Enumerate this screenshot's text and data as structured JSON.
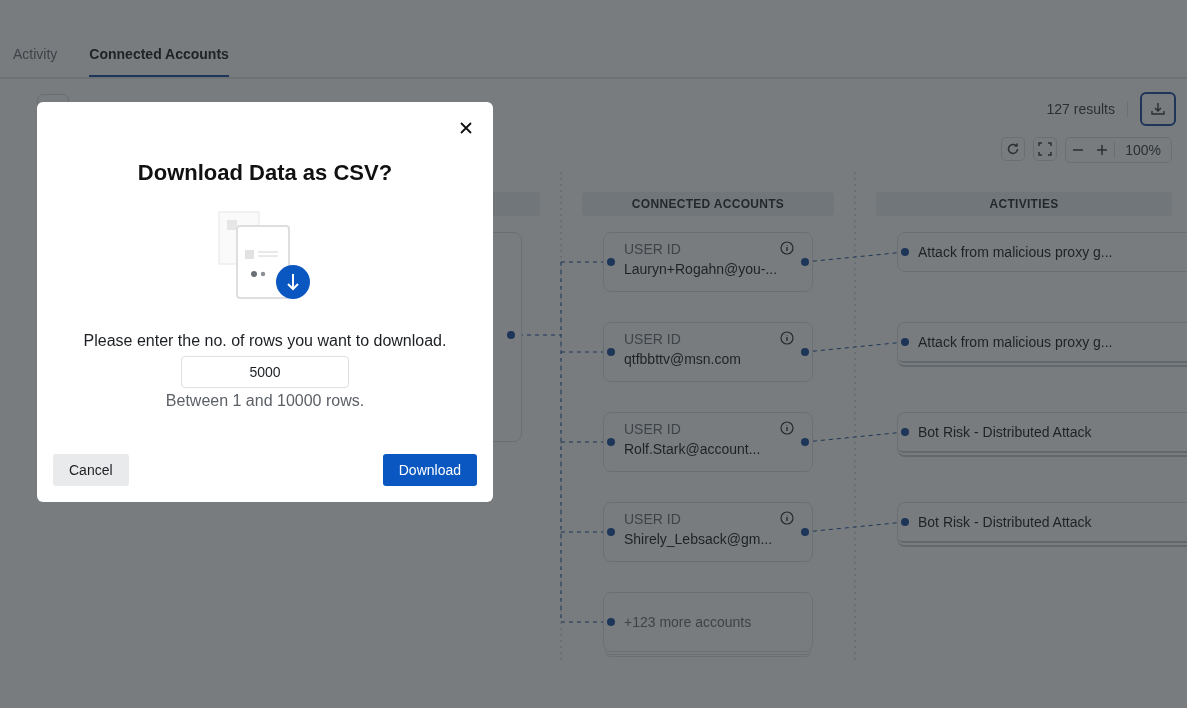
{
  "tabs": [
    {
      "label": "Activity",
      "selected": false
    },
    {
      "label": "Connected Accounts",
      "selected": true
    }
  ],
  "results": "127 results",
  "zoom": "100%",
  "graph": {
    "columns": [
      {
        "header": "CONNECTED ACCOUNTS"
      },
      {
        "header": "ACTIVITIES"
      }
    ],
    "accounts": [
      {
        "label": "USER ID",
        "value": "Lauryn+Rogahn@you-..."
      },
      {
        "label": "USER ID",
        "value": "qtfbbttv@msn.com"
      },
      {
        "label": "USER ID",
        "value": "Rolf.Stark@account..."
      },
      {
        "label": "USER ID",
        "value": "Shirely_Lebsack@gm..."
      }
    ],
    "more_accounts": "+123 more accounts",
    "activities": [
      {
        "text": "Attack from malicious proxy g...",
        "stacked": false
      },
      {
        "text": "Attack from malicious proxy g...",
        "stacked": true
      },
      {
        "text": "Bot Risk - Distributed Attack",
        "stacked": true
      },
      {
        "text": "Bot Risk - Distributed Attack",
        "stacked": true
      }
    ]
  },
  "dialog": {
    "title": "Download Data as CSV?",
    "prompt": "Please enter the no. of rows you want to download.",
    "rows_value": "5000",
    "hint": "Between 1 and 10000 rows.",
    "cancel": "Cancel",
    "confirm": "Download"
  }
}
